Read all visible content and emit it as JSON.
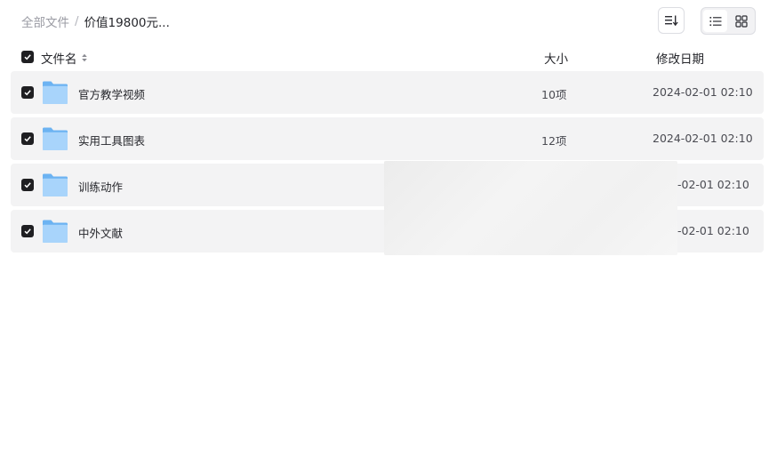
{
  "breadcrumb": {
    "root": "全部文件",
    "separator": "/",
    "current": "价值19800元..."
  },
  "toolbar": {
    "sort_icon": "sort-icon",
    "list_view_icon": "list-view-icon",
    "grid_view_icon": "grid-view-icon",
    "active_view": "list"
  },
  "header": {
    "name": "文件名",
    "size": "大小",
    "date": "修改日期",
    "all_checked": true
  },
  "files": [
    {
      "name": "官方教学视频",
      "size": "10项",
      "date": "2024-02-01 02:10",
      "checked": true
    },
    {
      "name": "实用工具图表",
      "size": "12项",
      "date": "2024-02-01 02:10",
      "checked": true
    },
    {
      "name": "训练动作",
      "size": "",
      "date": "-02-01 02:10",
      "checked": true
    },
    {
      "name": "中外文献",
      "size": "",
      "date": "-02-01 02:10",
      "checked": true
    }
  ],
  "colors": {
    "row_bg": "#f3f3f4",
    "checkbox": "#1f1f22",
    "folder_light": "#a8d4fb",
    "folder_dark": "#6cb3f2"
  }
}
